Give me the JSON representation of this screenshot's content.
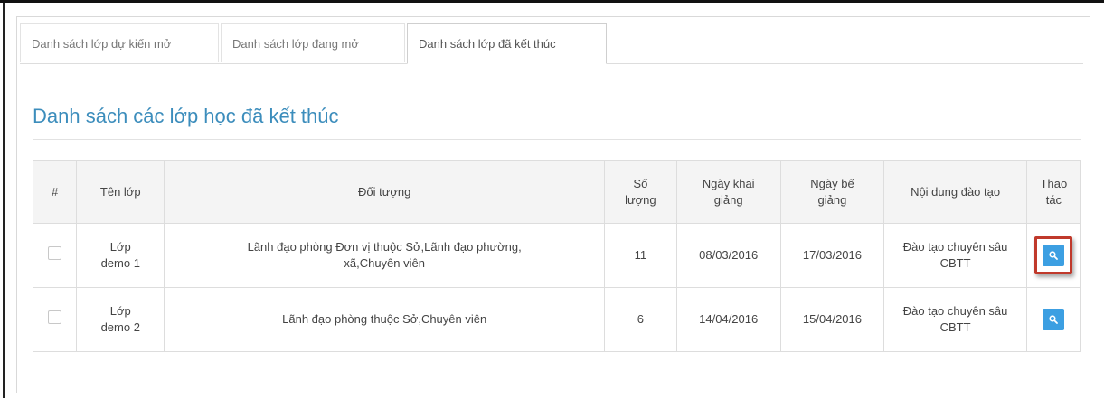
{
  "tabs": [
    {
      "label": "Danh sách lớp dự kiến mở",
      "active": false
    },
    {
      "label": "Danh sách lớp đang mở",
      "active": false
    },
    {
      "label": "Danh sách lớp đã kết thúc",
      "active": true
    }
  ],
  "page_title": "Danh sách các lớp học đã kết thúc",
  "table": {
    "headers": {
      "index": "#",
      "class_name": "Tên lớp",
      "target": "Đối tượng",
      "count_line1": "Số",
      "count_line2": "lượng",
      "start_line1": "Ngày khai",
      "start_line2": "giảng",
      "end_line1": "Ngày bế",
      "end_line2": "giảng",
      "content": "Nội dung đào tạo",
      "action_line1": "Thao",
      "action_line2": "tác"
    },
    "rows": [
      {
        "name_line1": "Lớp",
        "name_line2": "demo 1",
        "target_line1": "Lãnh đạo phòng Đơn vị thuộc Sở,Lãnh đạo phường,",
        "target_line2": "xã,Chuyên viên",
        "count": "11",
        "start": "08/03/2016",
        "end": "17/03/2016",
        "content_line1": "Đào tạo chuyên sâu",
        "content_line2": "CBTT",
        "action_icon": "search-icon",
        "highlighted": true
      },
      {
        "name_line1": "Lớp",
        "name_line2": "demo 2",
        "target_line1": "Lãnh đạo phòng thuộc Sở,Chuyên viên",
        "target_line2": "",
        "count": "6",
        "start": "14/04/2016",
        "end": "15/04/2016",
        "content_line1": "Đào tạo chuyên sâu",
        "content_line2": "CBTT",
        "action_icon": "search-icon",
        "highlighted": false
      }
    ]
  },
  "colors": {
    "accent": "#3c8dbc",
    "action_button": "#3c9fe2",
    "highlight_border": "#c0392b"
  }
}
